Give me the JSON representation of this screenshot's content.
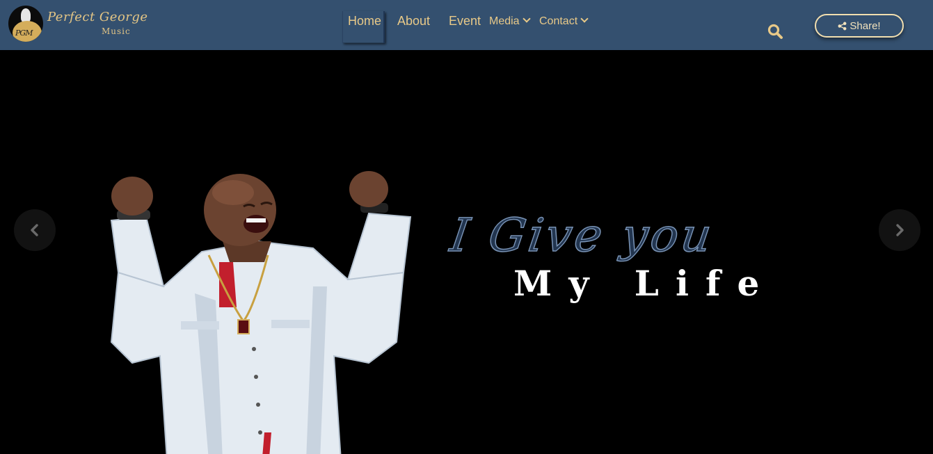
{
  "brand": {
    "name": "Perfect George",
    "sub": "Music",
    "badge": "PGM"
  },
  "nav": {
    "items": [
      {
        "label": "Home",
        "active": true
      },
      {
        "label": "About"
      },
      {
        "label": "Event"
      },
      {
        "label": "Media",
        "dropdown": true
      },
      {
        "label": "Contact",
        "dropdown": true
      }
    ]
  },
  "header": {
    "search_icon": "search-icon",
    "share_label": "Share!",
    "share_icon": "share-icon"
  },
  "hero": {
    "line1": "I Give you",
    "line2": "My Life",
    "prev_icon": "chevron-left-icon",
    "next_icon": "chevron-right-icon"
  },
  "colors": {
    "nav_bg": "#34506f",
    "accent_gold": "#e8c988",
    "hero_bg": "#000000",
    "caption_outline": "#7892b4"
  }
}
